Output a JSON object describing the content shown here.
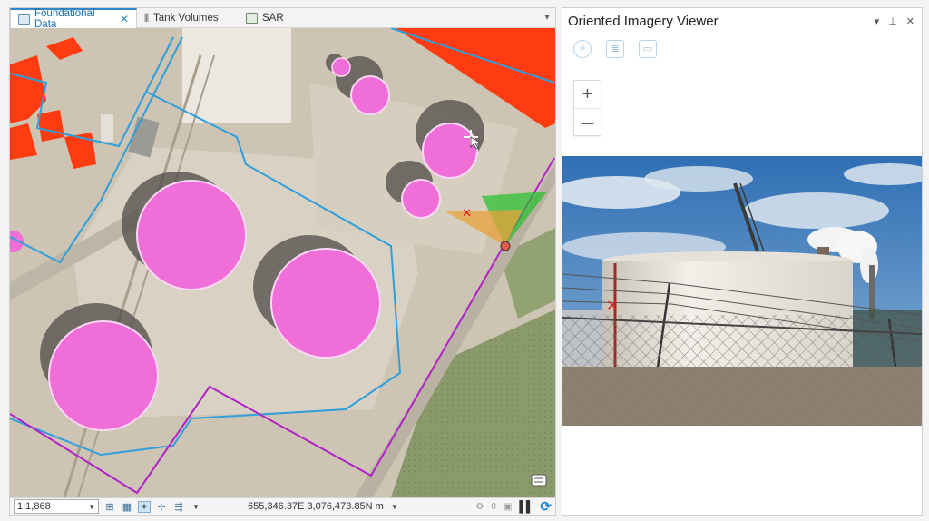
{
  "map": {
    "tabs": [
      {
        "label": "Foundational Data",
        "active": true,
        "icon": "map-icon"
      },
      {
        "label": "Tank Volumes",
        "active": false,
        "icon": "tank-chart-icon"
      },
      {
        "label": "SAR",
        "active": false,
        "icon": "raster-icon"
      }
    ],
    "close_glyph": "✕",
    "status": {
      "scale": "1:1,868",
      "coordinates": "655,346.37E 3,076,473.85N m",
      "selection_count": "0"
    },
    "colors": {
      "tank_fill": "#f06ed8",
      "boundary_line": "#2f9fdc",
      "parcel_line": "#b021c8",
      "roof_red": "#ff3b12",
      "camera_fov": "#22c22a"
    }
  },
  "viewer": {
    "title": "Oriented Imagery Viewer",
    "zoom_in": "+",
    "zoom_out": "—",
    "icons": [
      "compass-icon",
      "image-list-icon",
      "gallery-icon"
    ]
  }
}
